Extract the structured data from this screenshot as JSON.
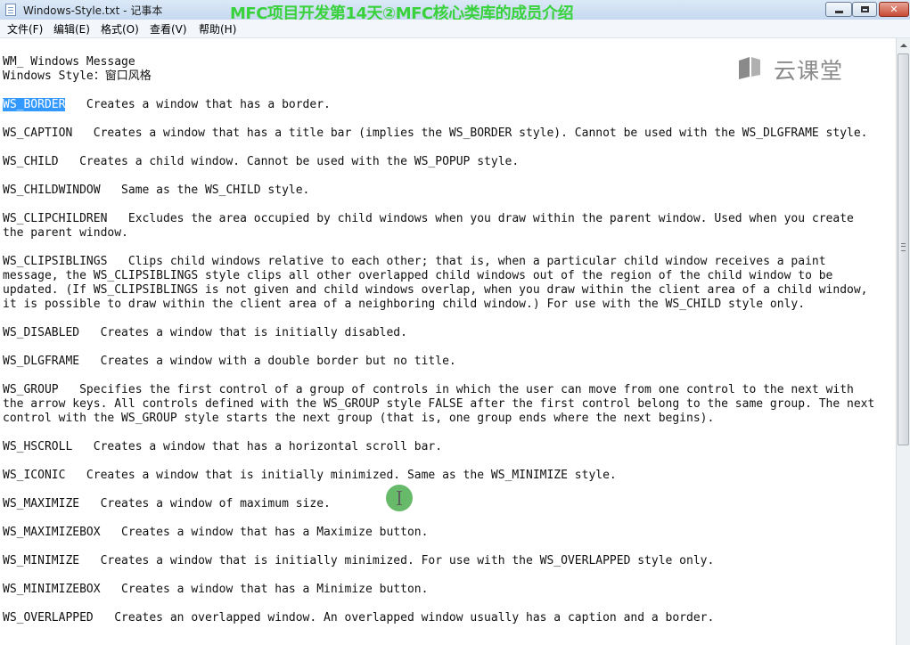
{
  "window": {
    "title": "Windows-Style.txt - 记事本",
    "overlay_caption": "MFC项目开发第14天②MFC核心类库的成员介绍",
    "close_label": "✕"
  },
  "menu": [
    {
      "label": "文件(F)"
    },
    {
      "label": "编辑(E)"
    },
    {
      "label": "格式(O)"
    },
    {
      "label": "查看(V)"
    },
    {
      "label": "帮助(H)"
    }
  ],
  "watermark": {
    "text": "云课堂",
    "icon": "cloud-classroom-icon"
  },
  "document": {
    "lines": [
      {
        "pre": "WM_ Windows Message"
      },
      {
        "pre": "Windows Style：窗口风格"
      },
      {
        "sel": "WS_BORDER",
        "post": "   Creates a window that has a border."
      },
      {
        "pre": "WS_CAPTION   Creates a window that has a title bar (implies the WS_BORDER style). Cannot be used with the WS_DLGFRAME style."
      },
      {
        "pre": "WS_CHILD   Creates a child window. Cannot be used with the WS_POPUP style."
      },
      {
        "pre": "WS_CHILDWINDOW   Same as the WS_CHILD style."
      },
      {
        "pre": "WS_CLIPCHILDREN   Excludes the area occupied by child windows when you draw within the parent window. Used when you create"
      },
      {
        "pre": "the parent window."
      },
      {
        "pre": "WS_CLIPSIBLINGS   Clips child windows relative to each other; that is, when a particular child window receives a paint"
      },
      {
        "pre": "message, the WS_CLIPSIBLINGS style clips all other overlapped child windows out of the region of the child window to be"
      },
      {
        "pre": "updated. (If WS_CLIPSIBLINGS is not given and child windows overlap, when you draw within the client area of a child window,"
      },
      {
        "pre": "it is possible to draw within the client area of a neighboring child window.) For use with the WS_CHILD style only."
      },
      {
        "pre": "WS_DISABLED   Creates a window that is initially disabled."
      },
      {
        "pre": "WS_DLGFRAME   Creates a window with a double border but no title."
      },
      {
        "pre": "WS_GROUP   Specifies the first control of a group of controls in which the user can move from one control to the next with"
      },
      {
        "pre": "the arrow keys. All controls defined with the WS_GROUP style FALSE after the first control belong to the same group. The next"
      },
      {
        "pre": "control with the WS_GROUP style starts the next group (that is, one group ends where the next begins)."
      },
      {
        "pre": "WS_HSCROLL   Creates a window that has a horizontal scroll bar."
      },
      {
        "pre": "WS_ICONIC   Creates a window that is initially minimized. Same as the WS_MINIMIZE style."
      },
      {
        "pre": "WS_MAXIMIZE   Creates a window of maximum size."
      },
      {
        "pre": "WS_MAXIMIZEBOX   Creates a window that has a Maximize button."
      },
      {
        "pre": "WS_MINIMIZE   Creates a window that is initially minimized. For use with the WS_OVERLAPPED style only."
      },
      {
        "pre": "WS_MINIMIZEBOX   Creates a window that has a Minimize button."
      },
      {
        "pre": "WS_OVERLAPPED   Creates an overlapped window. An overlapped window usually has a caption and a border."
      }
    ]
  }
}
